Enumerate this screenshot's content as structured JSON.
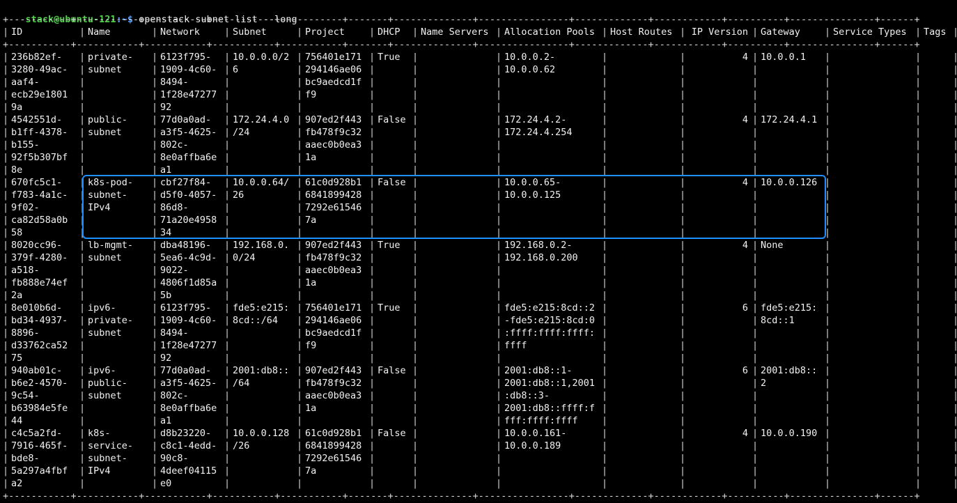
{
  "prompt": {
    "user_host": "stack@ubuntu-121",
    "path": ":~$",
    "command": " openstack subnet list --long"
  },
  "table": {
    "separator": "+-----------+-----------+-----------+-----------+-----------+-------+--------------+----------------+-------------+------------+----------+---------------+------+",
    "columns": [
      "ID",
      "Name",
      "Network",
      "Subnet",
      "Project",
      "DHCP",
      "Name Servers",
      "Allocation Pools",
      "Host Routes",
      "IP Version",
      "Gateway",
      "Service Types",
      "Tags"
    ],
    "rows": [
      {
        "id": [
          "236b82ef-",
          "3280-49ac-",
          "aaf4-",
          "ecb29e1801",
          "9a"
        ],
        "name": [
          "private-",
          "subnet"
        ],
        "network": [
          "6123f795-",
          "1909-4c60-",
          "8494-",
          "1f28e47277",
          "92"
        ],
        "subnet": [
          "10.0.0.0/2",
          "6"
        ],
        "project": [
          "756401e171",
          "294146ae06",
          "bc9aedcd1f",
          "f9"
        ],
        "dhcp": "True",
        "pools": [
          "10.0.0.2-",
          "10.0.0.62"
        ],
        "ip_version": "4",
        "gateway": [
          "10.0.0.1"
        ]
      },
      {
        "id": [
          "4542551d-",
          "b1ff-4378-",
          "b155-",
          "92f5b307bf",
          "8e"
        ],
        "name": [
          "public-",
          "subnet"
        ],
        "network": [
          "77d0a0ad-",
          "a3f5-4625-",
          "802c-",
          "8e0affba6e",
          "a1"
        ],
        "subnet": [
          "172.24.4.0",
          "/24"
        ],
        "project": [
          "907ed2f443",
          "fb478f9c32",
          "aaec0b0ea3",
          "1a"
        ],
        "dhcp": "False",
        "pools": [
          "172.24.4.2-",
          "172.24.4.254"
        ],
        "ip_version": "4",
        "gateway": [
          "172.24.4.1"
        ]
      },
      {
        "id": [
          "670fc5c1-",
          "f783-4a1c-",
          "9f02-",
          "ca82d58a0b",
          "58"
        ],
        "name": [
          "k8s-pod-",
          "subnet-",
          "IPv4"
        ],
        "network": [
          "cbf27f84-",
          "d5f0-4057-",
          "86d8-",
          "71a20e4958",
          "34"
        ],
        "subnet": [
          "10.0.0.64/",
          "26"
        ],
        "project": [
          "61c0d928b1",
          "6841899428",
          "7292e61546",
          "7a"
        ],
        "dhcp": "False",
        "pools": [
          "10.0.0.65-",
          "10.0.0.125"
        ],
        "ip_version": "4",
        "gateway": [
          "10.0.0.126"
        ]
      },
      {
        "id": [
          "8020cc96-",
          "379f-4280-",
          "a518-",
          "fb888e74ef",
          "2a"
        ],
        "name": [
          "lb-mgmt-",
          "subnet"
        ],
        "network": [
          "dba48196-",
          "5ea6-4c9d-",
          "9022-",
          "4806f1d85a",
          "5b"
        ],
        "subnet": [
          "192.168.0.",
          "0/24"
        ],
        "project": [
          "907ed2f443",
          "fb478f9c32",
          "aaec0b0ea3",
          "1a"
        ],
        "dhcp": "True",
        "pools": [
          "192.168.0.2-",
          "192.168.0.200"
        ],
        "ip_version": "4",
        "gateway": [
          "None"
        ]
      },
      {
        "id": [
          "8e010b6d-",
          "bd34-4937-",
          "8896-",
          "d33762ca52",
          "75"
        ],
        "name": [
          "ipv6-",
          "private-",
          "subnet"
        ],
        "network": [
          "6123f795-",
          "1909-4c60-",
          "8494-",
          "1f28e47277",
          "92"
        ],
        "subnet": [
          "fde5:e215:",
          "8cd::/64"
        ],
        "project": [
          "756401e171",
          "294146ae06",
          "bc9aedcd1f",
          "f9"
        ],
        "dhcp": "True",
        "pools": [
          "fde5:e215:8cd::2",
          "-fde5:e215:8cd:0",
          ":ffff:ffff:ffff:",
          "ffff"
        ],
        "ip_version": "6",
        "gateway": [
          "fde5:e215:",
          "8cd::1"
        ]
      },
      {
        "id": [
          "940ab01c-",
          "b6e2-4570-",
          "9c54-",
          "b63984e5fe",
          "44"
        ],
        "name": [
          "ipv6-",
          "public-",
          "subnet"
        ],
        "network": [
          "77d0a0ad-",
          "a3f5-4625-",
          "802c-",
          "8e0affba6e",
          "a1"
        ],
        "subnet": [
          "2001:db8::",
          "/64"
        ],
        "project": [
          "907ed2f443",
          "fb478f9c32",
          "aaec0b0ea3",
          "1a"
        ],
        "dhcp": "False",
        "pools": [
          "2001:db8::1-",
          "2001:db8::1,2001",
          ":db8::3-",
          "2001:db8::ffff:f",
          "fff:ffff:ffff"
        ],
        "ip_version": "6",
        "gateway": [
          "2001:db8::",
          "2"
        ]
      },
      {
        "id": [
          "c4c5a2fd-",
          "7916-465f-",
          "bde8-",
          "5a297a4fbf",
          "a2"
        ],
        "name": [
          "k8s-",
          "service-",
          "subnet-",
          "IPv4"
        ],
        "network": [
          "d8b23220-",
          "c8c1-4edd-",
          "90c8-",
          "4deef04115",
          "e0"
        ],
        "subnet": [
          "10.0.0.128",
          "/26"
        ],
        "project": [
          "61c0d928b1",
          "6841899428",
          "7292e61546",
          "7a"
        ],
        "dhcp": "False",
        "pools": [
          "10.0.0.161-",
          "10.0.0.189"
        ],
        "ip_version": "4",
        "gateway": [
          "10.0.0.190"
        ]
      }
    ]
  },
  "colors": {
    "background": "#000000",
    "text": "#f2f2f2",
    "prompt_user": "#4fd24a",
    "prompt_path": "#5aa0ff",
    "highlight": "#1e90ff"
  }
}
